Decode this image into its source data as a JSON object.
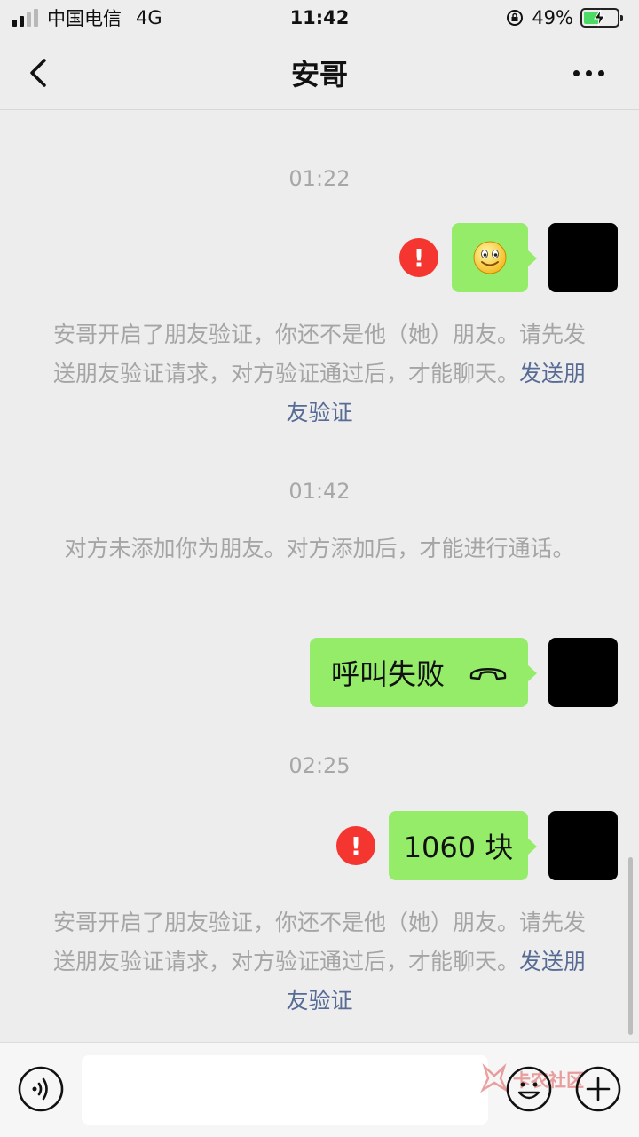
{
  "status_bar": {
    "carrier": "中国电信",
    "network": "4G",
    "time": "11:42",
    "battery_percent": "49%",
    "battery_level": 0.49,
    "battery_color": "#4cd964"
  },
  "header": {
    "title": "安哥",
    "back_icon": "chevron-left-icon",
    "more_icon": "ellipsis-icon"
  },
  "messages": {
    "t1": "01:22",
    "emoji_bubble_icon": "smiley-emoji-icon",
    "sys1_text": "安哥开启了朋友验证，你还不是他（她）朋友。请先发送朋友验证请求，对方验证通过后，才能聊天。",
    "sys1_link": "发送朋友验证",
    "t2": "01:42",
    "sys2_text": "对方未添加你为朋友。对方添加后，才能进行通话。",
    "call_failed": "呼叫失败",
    "t3": "02:25",
    "amount_msg": "1060 块",
    "sys3_text": "安哥开启了朋友验证，你还不是他（她）朋友。请先发送朋友验证请求，对方验证通过后，才能聊天。",
    "sys3_link": "发送朋友验证",
    "error_mark": "!"
  },
  "input_bar": {
    "voice_icon": "voice-icon",
    "emoji_icon": "emoji-icon",
    "plus_icon": "plus-icon"
  },
  "watermark": {
    "text": "卡农社区"
  },
  "colors": {
    "bubble": "#95ec69",
    "error": "#f43530",
    "link": "#576b95",
    "background": "#ededed"
  }
}
